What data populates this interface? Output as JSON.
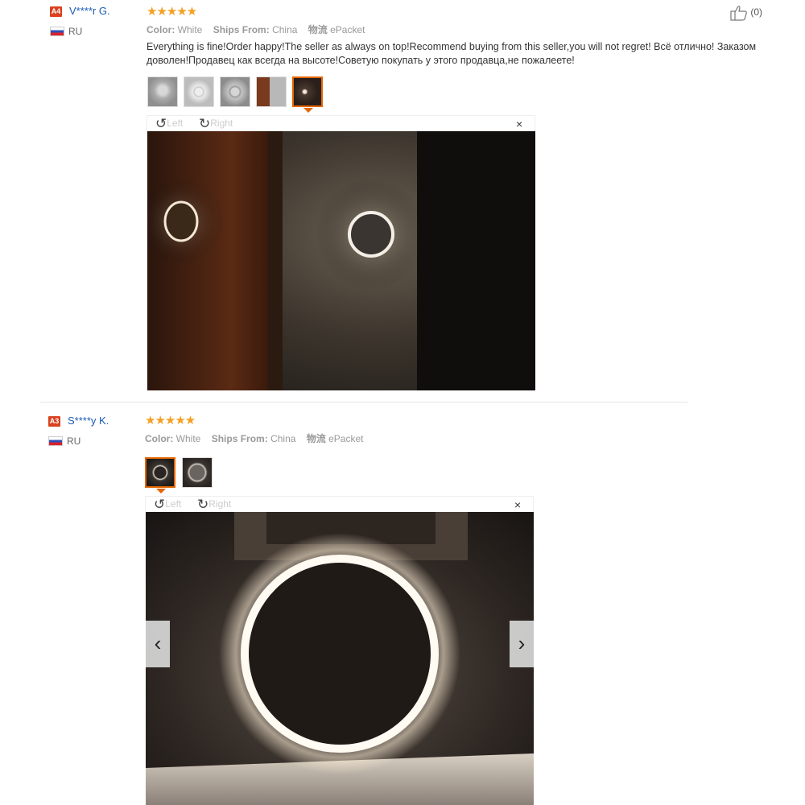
{
  "reviews": [
    {
      "level": "A4",
      "user": "V****r G.",
      "country": "RU",
      "stars": "★★★★★",
      "color_label": "Color:",
      "color_value": "White",
      "ships_label": "Ships From:",
      "ships_value": "China",
      "logistics_label": "物流",
      "logistics_value": "ePacket",
      "text": "Everything is fine!Order happy!The seller as always on top!Recommend buying from this seller,you will not regret! Всё отлично! Заказом доволен!Продавец как всегда на высоте!Советую покупать у этого продавца,не пожалеете!",
      "helpful": "(0)",
      "viewer": {
        "left": "Left",
        "right": "Right",
        "close": "×"
      }
    },
    {
      "level": "A3",
      "user": "S****y K.",
      "country": "RU",
      "stars": "★★★★★",
      "color_label": "Color:",
      "color_value": "White",
      "ships_label": "Ships From:",
      "ships_value": "China",
      "logistics_label": "物流",
      "logistics_value": "ePacket",
      "viewer": {
        "left": "Left",
        "right": "Right",
        "close": "×",
        "prev": "‹",
        "next": "›"
      }
    }
  ],
  "icons": {
    "thumbs_up": "thumbs-up-icon",
    "rotate_left": "rotate-left-icon",
    "rotate_right": "rotate-right-icon",
    "close": "close-icon",
    "prev": "chevron-left-icon",
    "next": "chevron-right-icon"
  },
  "colors": {
    "username": "#1a5bb4",
    "stars": "#f5a023",
    "level_badge": "#d9411e",
    "selected_thumb": "#e56600"
  }
}
